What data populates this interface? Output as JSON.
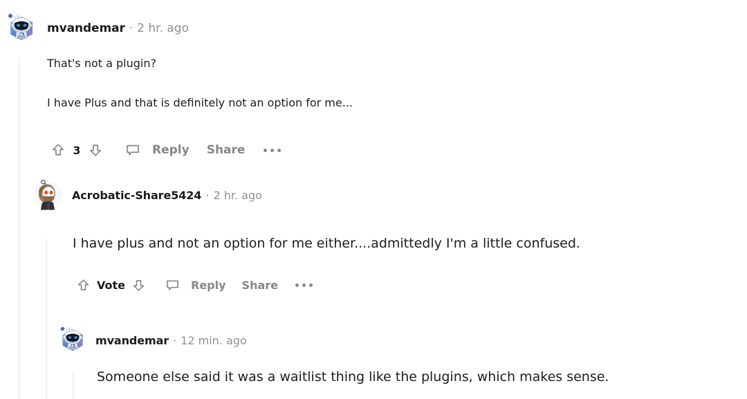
{
  "page": {
    "type": "reddit-comment-thread",
    "background_color": "#ffffff",
    "text_color": "#1c1c1c",
    "muted_text_color": "#8d9094",
    "threadline_color": "#edeff1"
  },
  "comments": [
    {
      "depth": 0,
      "username": "mvandemar",
      "separator": "·",
      "timestamp": "2 hr. ago",
      "avatar_name": "robot-snoo-avatar",
      "body_paragraphs": [
        "That's not a plugin?",
        "I have Plus and that is definitely not an option for me..."
      ],
      "actions": {
        "upvote_label": "upvote",
        "score": "3",
        "downvote_label": "downvote",
        "comment_icon_label": "comment",
        "reply_label": "Reply",
        "share_label": "Share",
        "more_label": "more options"
      }
    },
    {
      "depth": 1,
      "username": "Acrobatic-Share5424",
      "separator": "·",
      "timestamp": "2 hr. ago",
      "avatar_name": "bearded-snoo-avatar",
      "body_paragraphs": [
        "I have plus and not an option for me either....admittedly I'm a little confused."
      ],
      "actions": {
        "upvote_label": "upvote",
        "score": "Vote",
        "downvote_label": "downvote",
        "comment_icon_label": "comment",
        "reply_label": "Reply",
        "share_label": "Share",
        "more_label": "more options"
      }
    },
    {
      "depth": 2,
      "username": "mvandemar",
      "separator": "·",
      "timestamp": "12 min. ago",
      "avatar_name": "robot-snoo-avatar",
      "body_paragraphs": [
        "Someone else said it was a waitlist thing like the plugins, which makes sense."
      ],
      "actions": null
    }
  ]
}
